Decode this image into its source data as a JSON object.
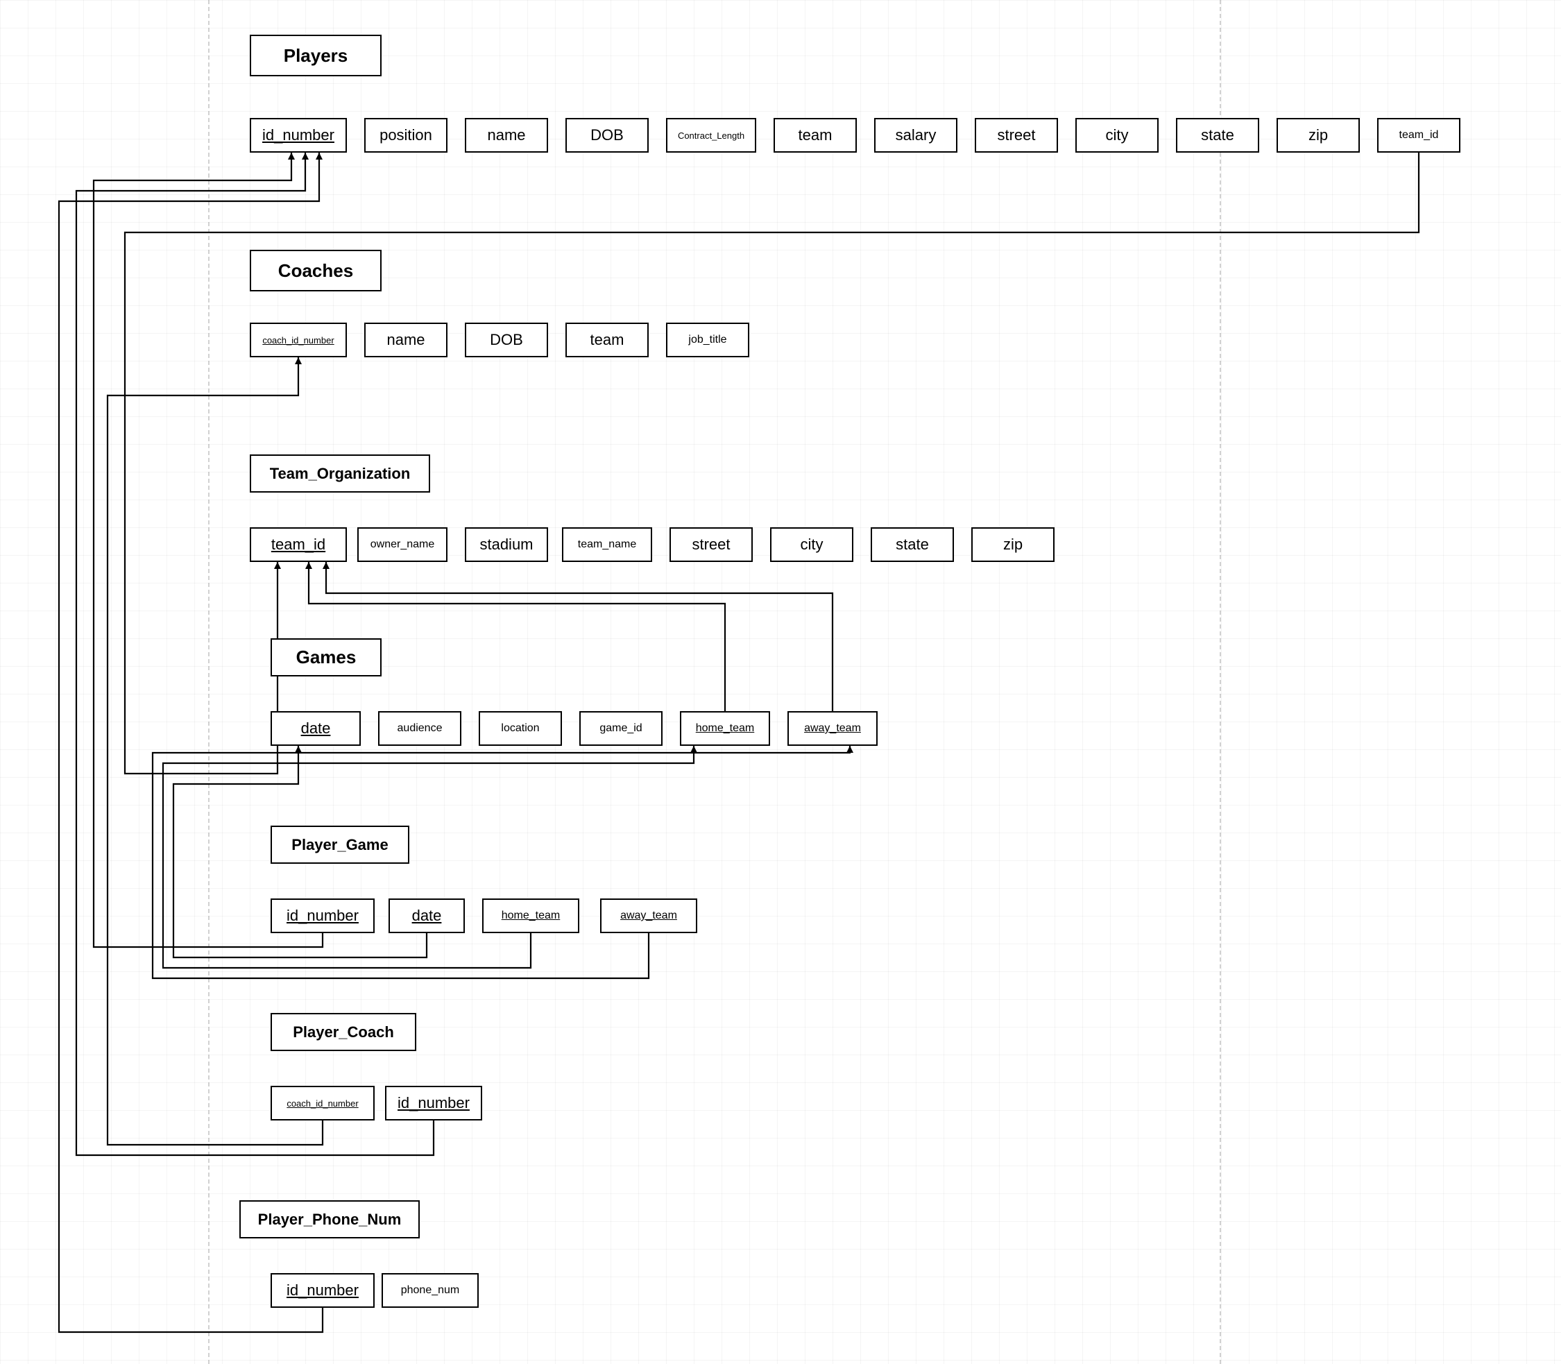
{
  "entities": {
    "players": {
      "title": "Players",
      "attrs": [
        "id_number",
        "position",
        "name",
        "DOB",
        "Contract_Length",
        "team",
        "salary",
        "street",
        "city",
        "state",
        "zip",
        "team_id"
      ]
    },
    "coaches": {
      "title": "Coaches",
      "attrs": [
        "coach_id_number",
        "name",
        "DOB",
        "team",
        "job_title"
      ]
    },
    "team_org": {
      "title": "Team_Organization",
      "attrs": [
        "team_id",
        "owner_name",
        "stadium",
        "team_name",
        "street",
        "city",
        "state",
        "zip"
      ]
    },
    "games": {
      "title": "Games",
      "attrs": [
        "date",
        "audience",
        "location",
        "game_id",
        "home_team",
        "away_team"
      ]
    },
    "player_game": {
      "title": "Player_Game",
      "attrs": [
        "id_number",
        "date",
        "home_team",
        "away_team"
      ]
    },
    "player_coach": {
      "title": "Player_Coach",
      "attrs": [
        "coach_id_number",
        "id_number"
      ]
    },
    "player_phone": {
      "title": "Player_Phone_Num",
      "attrs": [
        "id_number",
        "phone_num"
      ]
    }
  },
  "relationships_described": [
    "Players.team_id -> Team_Organization.team_id",
    "Player_Game.id_number -> Players.id_number",
    "Player_Game.date -> Games.date",
    "Player_Game.home_team -> Games.home_team",
    "Player_Game.away_team -> Games.away_team",
    "Games.home_team -> Team_Organization.team_id",
    "Games.away_team -> Team_Organization.team_id",
    "Player_Coach.coach_id_number -> Coaches.coach_id_number",
    "Player_Coach.id_number -> Players.id_number",
    "Player_Phone_Num.id_number -> Players.id_number"
  ]
}
